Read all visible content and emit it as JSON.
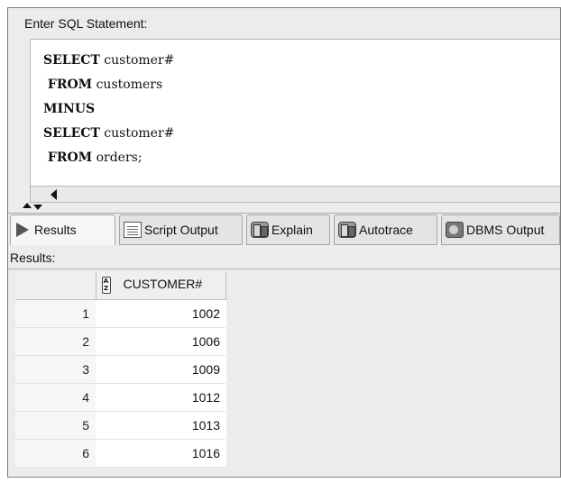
{
  "editor": {
    "label": "Enter SQL Statement:",
    "lines": [
      {
        "keyword": "SELECT",
        "rest": " customer#"
      },
      {
        "keyword": " FROM",
        "rest": " customers"
      },
      {
        "keyword": "MINUS",
        "rest": ""
      },
      {
        "keyword": "SELECT",
        "rest": " customer#"
      },
      {
        "keyword": " FROM",
        "rest": " orders;"
      }
    ]
  },
  "tabs": [
    {
      "label": "Results",
      "icon": "play-icon",
      "active": true
    },
    {
      "label": "Script Output",
      "icon": "script-output-icon",
      "active": false
    },
    {
      "label": "Explain",
      "icon": "explain-icon",
      "active": false
    },
    {
      "label": "Autotrace",
      "icon": "autotrace-icon",
      "active": false
    },
    {
      "label": "DBMS Output",
      "icon": "dbms-output-icon",
      "active": false
    }
  ],
  "results": {
    "label": "Results:",
    "sort_icon_text": "A Z",
    "columns": [
      "CUSTOMER#"
    ],
    "rows": [
      {
        "n": "1",
        "customer": "1002"
      },
      {
        "n": "2",
        "customer": "1006"
      },
      {
        "n": "3",
        "customer": "1009"
      },
      {
        "n": "4",
        "customer": "1012"
      },
      {
        "n": "5",
        "customer": "1013"
      },
      {
        "n": "6",
        "customer": "1016"
      }
    ]
  }
}
